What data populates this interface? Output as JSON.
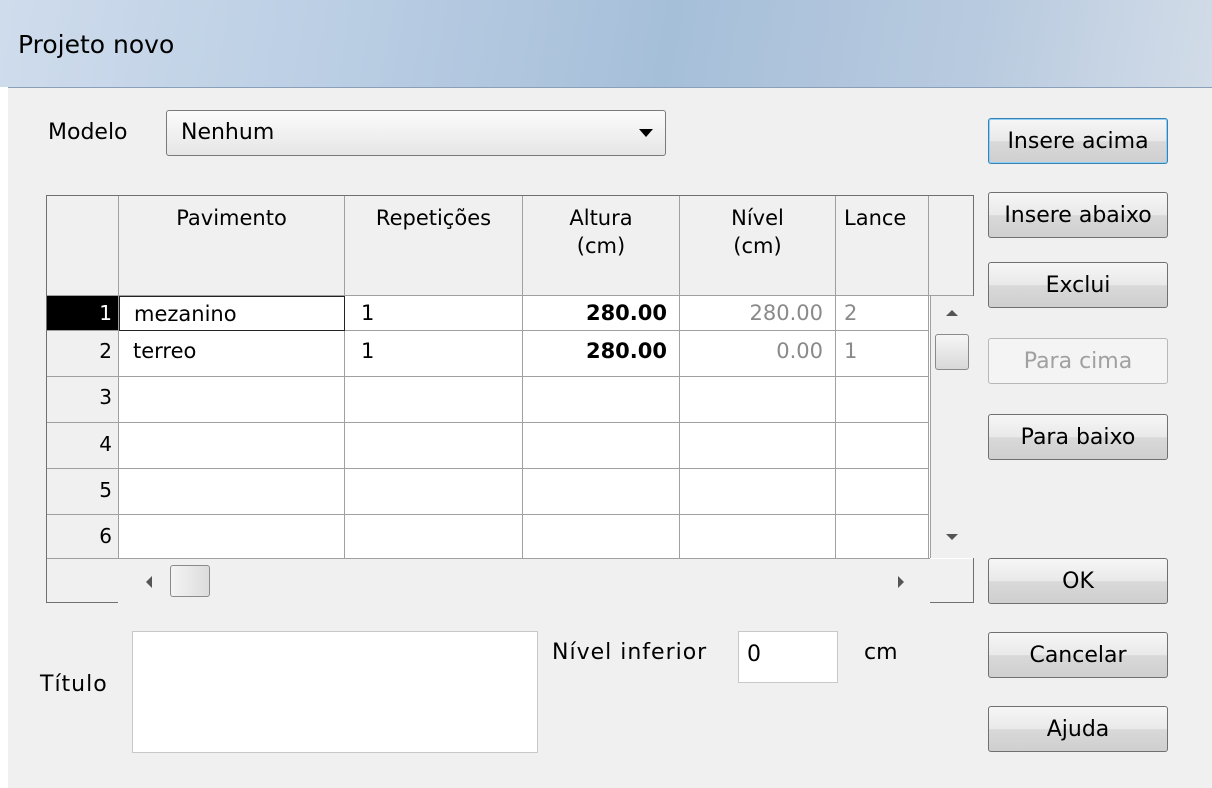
{
  "window": {
    "title": "Projeto novo"
  },
  "modelo": {
    "label": "Modelo",
    "value": "Nenhum"
  },
  "grid": {
    "columns": [
      "",
      "Pavimento",
      "Repetições",
      "Altura\n(cm)",
      "Nível\n(cm)",
      "Lance"
    ],
    "rows": [
      {
        "n": "1",
        "pavimento": "mezanino",
        "repeticoes": "1",
        "altura": "280.00",
        "nivel": "280.00",
        "lance": "2"
      },
      {
        "n": "2",
        "pavimento": "terreo",
        "repeticoes": "1",
        "altura": "280.00",
        "nivel": "0.00",
        "lance": "1"
      },
      {
        "n": "3",
        "pavimento": "",
        "repeticoes": "",
        "altura": "",
        "nivel": "",
        "lance": ""
      },
      {
        "n": "4",
        "pavimento": "",
        "repeticoes": "",
        "altura": "",
        "nivel": "",
        "lance": ""
      },
      {
        "n": "5",
        "pavimento": "",
        "repeticoes": "",
        "altura": "",
        "nivel": "",
        "lance": ""
      },
      {
        "n": "6",
        "pavimento": "",
        "repeticoes": "",
        "altura": "",
        "nivel": "",
        "lance": ""
      }
    ]
  },
  "buttons": {
    "insere_acima": "Insere acima",
    "insere_abaixo": "Insere abaixo",
    "exclui": "Exclui",
    "para_cima": "Para cima",
    "para_baixo": "Para baixo",
    "ok": "OK",
    "cancelar": "Cancelar",
    "ajuda": "Ajuda"
  },
  "titulo": {
    "label": "Título",
    "value": ""
  },
  "nivel_inferior": {
    "label": "Nível inferior",
    "value": "0",
    "unit": "cm"
  }
}
